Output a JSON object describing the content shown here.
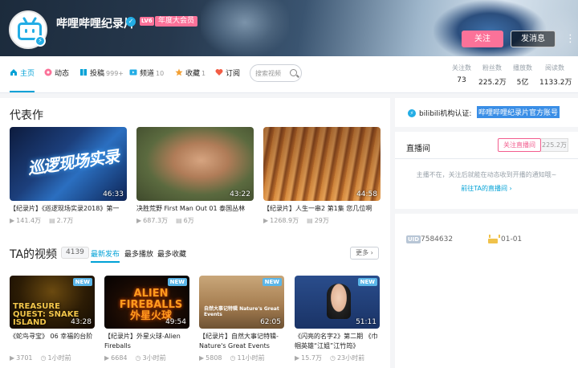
{
  "header": {
    "username": "哔哩哔哩纪录片",
    "level_badge": "LV6",
    "vip_badge": "年度大会员",
    "follow_label": "关注",
    "message_label": "发消息",
    "more_label": "⋮"
  },
  "nav": {
    "items": [
      {
        "label": "主页",
        "count": ""
      },
      {
        "label": "动态",
        "count": ""
      },
      {
        "label": "投稿",
        "count": "999+"
      },
      {
        "label": "频道",
        "count": "10"
      },
      {
        "label": "收藏",
        "count": "1"
      },
      {
        "label": "订阅",
        "count": ""
      }
    ],
    "search_placeholder": "搜索视频"
  },
  "stats": [
    {
      "label": "关注数",
      "value": "73"
    },
    {
      "label": "粉丝数",
      "value": "225.2万"
    },
    {
      "label": "播放数",
      "value": "5亿"
    },
    {
      "label": "阅读数",
      "value": "1133.2万"
    }
  ],
  "featured": {
    "title": "代表作",
    "videos": [
      {
        "title": "【纪录片】《巡逻现场实录2018》第一",
        "duration": "46:33",
        "plays": "141.4万",
        "danmaku": "2.7万",
        "thumb_text": "巡逻现场实录"
      },
      {
        "title": "决胜荒野 First Man Out 01 泰国丛林",
        "duration": "43:22",
        "plays": "687.3万",
        "danmaku": "6万"
      },
      {
        "title": "【纪录片】人生一串2 第1集 您几位啊",
        "duration": "44:58",
        "plays": "1268.9万",
        "danmaku": "29万"
      }
    ]
  },
  "ta_videos": {
    "title": "TA的视频",
    "count": "4139",
    "tabs": [
      "最新发布",
      "最多播放",
      "最多收藏"
    ],
    "more_label": "更多",
    "new_badge": "NEW",
    "videos": [
      {
        "title": "《蛇鸟寻宝》 06 幸福的台阶",
        "duration": "43:28",
        "plays": "3701",
        "time": "1小时前",
        "thumb_text": "TREASURE QUEST: SNAKE ISLAND"
      },
      {
        "title": "【纪录片】外星火球-Alien Fireballs",
        "duration": "49:54",
        "plays": "6684",
        "time": "3小时前",
        "thumb_text": "ALIEN FIREBALLS 外星火球"
      },
      {
        "title": "【纪录片】自然大事记特辑-Nature's Great Events",
        "duration": "62:05",
        "plays": "5808",
        "time": "11小时前",
        "thumb_text": "自然大事记特辑 Nature's Great Events"
      },
      {
        "title": "《闪亮的名字2》第二期 《巾帼英雄“江姐”江竹筠》",
        "duration": "51:11",
        "plays": "15.7万",
        "time": "23小时前"
      }
    ]
  },
  "org": {
    "label": "bilibili机构认证:",
    "value": "哔哩哔哩纪录片官方账号"
  },
  "live": {
    "title": "直播间",
    "follow_label": "关注直播间",
    "count": "225.2万",
    "message": "主播不在，关注后就能在动态收到开播的通知哦~",
    "link": "前往TA的直播间"
  },
  "profile": {
    "uid_label": "UID",
    "uid": "7584632",
    "birthday": "01-01"
  },
  "colors": {
    "accent": "#00a1d6",
    "pink": "#fb7299"
  }
}
